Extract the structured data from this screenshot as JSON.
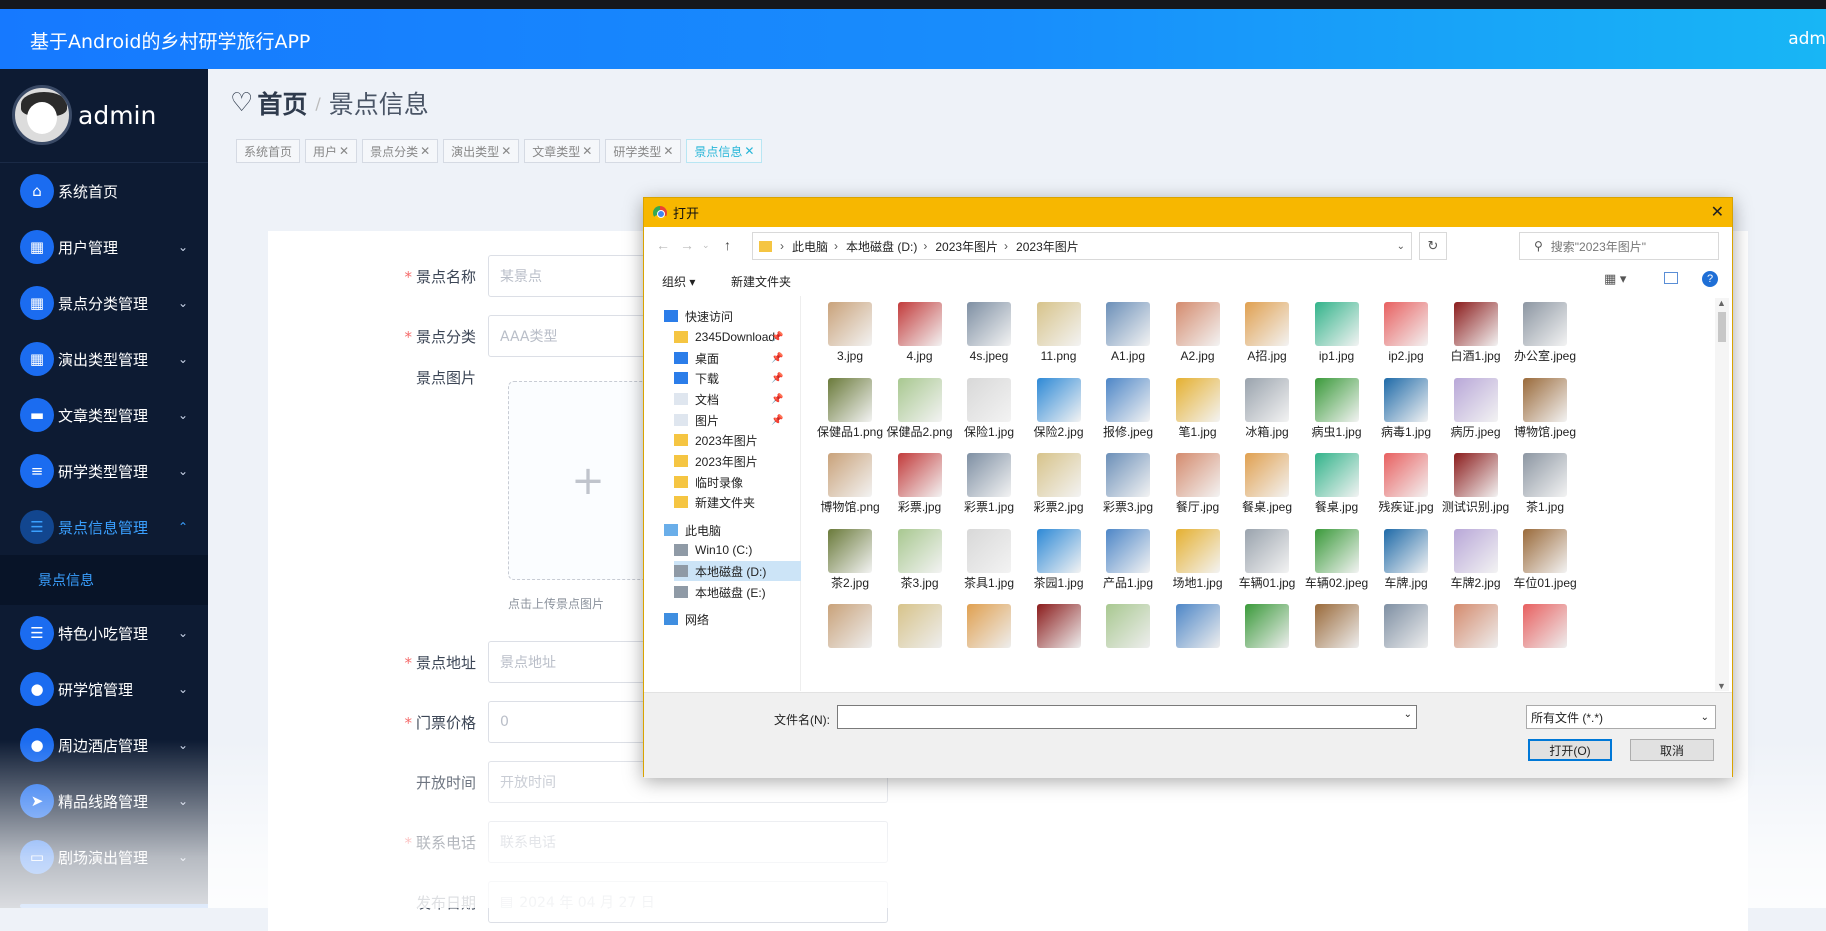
{
  "header": {
    "title": "基于Android的乡村研学旅行APP",
    "user": "adm"
  },
  "sidebar": {
    "username": "admin",
    "items": [
      {
        "label": "系统首页",
        "icon": "home-icon",
        "glyph": "⌂",
        "chevron": ""
      },
      {
        "label": "用户管理",
        "icon": "grid-icon",
        "glyph": "▦",
        "chevron": "⌄"
      },
      {
        "label": "景点分类管理",
        "icon": "grid-icon",
        "glyph": "▦",
        "chevron": "⌄"
      },
      {
        "label": "演出类型管理",
        "icon": "grid-icon",
        "glyph": "▦",
        "chevron": "⌄"
      },
      {
        "label": "文章类型管理",
        "icon": "chat-icon",
        "glyph": "▬",
        "chevron": "⌄"
      },
      {
        "label": "研学类型管理",
        "icon": "sliders-icon",
        "glyph": "≡",
        "chevron": "⌄"
      },
      {
        "label": "景点信息管理",
        "icon": "list-icon",
        "glyph": "☰",
        "chevron": "⌃",
        "active": true
      },
      {
        "label": "特色小吃管理",
        "icon": "list-icon",
        "glyph": "☰",
        "chevron": "⌄"
      },
      {
        "label": "研学馆管理",
        "icon": "user-icon",
        "glyph": "●",
        "chevron": "⌄"
      },
      {
        "label": "周边酒店管理",
        "icon": "bulb-icon",
        "glyph": "●",
        "chevron": "⌄"
      },
      {
        "label": "精品线路管理",
        "icon": "send-icon",
        "glyph": "➤",
        "chevron": "⌄"
      },
      {
        "label": "剧场演出管理",
        "icon": "monitor-icon",
        "glyph": "▭",
        "chevron": "⌄"
      }
    ],
    "sub_item": "景点信息"
  },
  "breadcrumb": {
    "home": "首页",
    "sep": "/",
    "current": "景点信息"
  },
  "tags": [
    "系统首页",
    "用户",
    "景点分类",
    "演出类型",
    "文章类型",
    "研学类型",
    "景点信息"
  ],
  "form": {
    "name_label": "景点名称",
    "name_placeholder": "某景点",
    "cat_label": "景点分类",
    "cat_placeholder": "AAA类型",
    "img_label": "景点图片",
    "img_hint": "点击上传景点图片",
    "addr_label": "景点地址",
    "addr_placeholder": "景点地址",
    "price_label": "门票价格",
    "price_placeholder": "0",
    "open_label": "开放时间",
    "open_placeholder": "开放时间",
    "phone_label": "联系电话",
    "phone_placeholder": "联系电话",
    "date_label": "发布日期",
    "date_value": "2024 年 04 月 27 日"
  },
  "dialog": {
    "title": "打开",
    "path": [
      "此电脑",
      "本地磁盘 (D:)",
      "2023年图片",
      "2023年图片"
    ],
    "search_placeholder": "搜索\"2023年图片\"",
    "organize": "组织 ▾",
    "new_folder": "新建文件夹",
    "nav": [
      {
        "label": "快速访问",
        "icon": "star-icon"
      },
      {
        "label": "2345Download",
        "icon": "folder-icon",
        "pinned": true
      },
      {
        "label": "桌面",
        "icon": "desktop-icon",
        "pinned": true
      },
      {
        "label": "下载",
        "icon": "download-icon",
        "pinned": true
      },
      {
        "label": "文档",
        "icon": "document-icon",
        "pinned": true
      },
      {
        "label": "图片",
        "icon": "picture-icon",
        "pinned": true
      },
      {
        "label": "2023年图片",
        "icon": "folder-icon"
      },
      {
        "label": "2023年图片",
        "icon": "folder-icon"
      },
      {
        "label": "临时录像",
        "icon": "folder-icon"
      },
      {
        "label": "新建文件夹",
        "icon": "folder-icon"
      },
      {
        "label": "此电脑",
        "icon": "computer-icon"
      },
      {
        "label": "Win10 (C:)",
        "icon": "drive-icon"
      },
      {
        "label": "本地磁盘 (D:)",
        "icon": "drive-icon",
        "selected": true
      },
      {
        "label": "本地磁盘 (E:)",
        "icon": "drive-icon"
      },
      {
        "label": "网络",
        "icon": "network-icon"
      }
    ],
    "files": [
      [
        "3.jpg",
        "4.jpg",
        "4s.jpeg",
        "11.png",
        "A1.jpg",
        "A2.jpg",
        "A招.jpg",
        "ip1.jpg",
        "ip2.jpg",
        "白酒1.jpg",
        "办公室.jpeg"
      ],
      [
        "保健品1.png",
        "保健品2.png",
        "保险1.jpg",
        "保险2.jpg",
        "报修.jpeg",
        "笔1.jpg",
        "冰箱.jpg",
        "病虫1.jpg",
        "病毒1.jpg",
        "病历.jpeg",
        "博物馆.jpeg"
      ],
      [
        "博物馆.png",
        "彩票.jpg",
        "彩票1.jpg",
        "彩票2.jpg",
        "彩票3.jpg",
        "餐厅.jpg",
        "餐桌.jpeg",
        "餐桌.jpg",
        "残疾证.jpg",
        "测试识别.jpg",
        "茶1.jpg"
      ],
      [
        "茶2.jpg",
        "茶3.jpg",
        "茶具1.jpg",
        "茶园1.jpg",
        "产品1.jpg",
        "场地1.jpg",
        "车辆01.jpg",
        "车辆02.jpeg",
        "车牌.jpg",
        "车牌2.jpg",
        "车位01.jpeg"
      ]
    ],
    "filename_label": "文件名(N):",
    "filetype": "所有文件 (*.*)",
    "open_btn": "打开(O)",
    "cancel_btn": "取消"
  }
}
